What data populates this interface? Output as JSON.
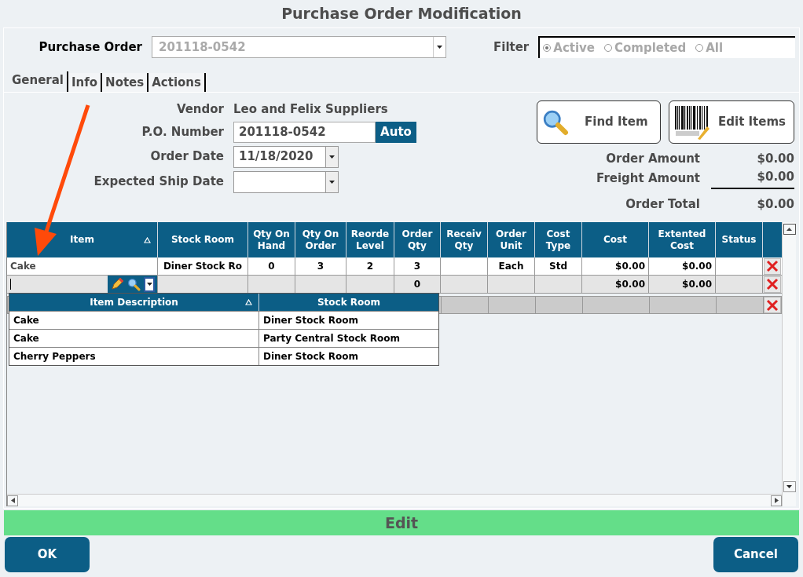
{
  "title": "Purchase Order Modification",
  "purchase_order": {
    "label": "Purchase Order",
    "value": "201118-0542"
  },
  "filter": {
    "label": "Filter",
    "options": [
      {
        "label": "Active",
        "selected": true
      },
      {
        "label": "Completed",
        "selected": false
      },
      {
        "label": "All",
        "selected": false
      }
    ]
  },
  "tabs": [
    {
      "label": "General",
      "selected": true
    },
    {
      "label": "Info",
      "selected": false
    },
    {
      "label": "Notes",
      "selected": false
    },
    {
      "label": "Actions",
      "selected": false
    }
  ],
  "form": {
    "vendor_label": "Vendor",
    "vendor": "Leo and Felix Suppliers",
    "po_label": "P.O. Number",
    "po_value": "201118-0542",
    "auto_button": "Auto",
    "order_date_label": "Order Date",
    "order_date": "11/18/2020",
    "ship_date_label": "Expected Ship Date"
  },
  "find_button": "Find Item",
  "edit_button": "Edit Items",
  "totals": [
    {
      "label": "Order Amount",
      "value": "$0.00"
    },
    {
      "label": "Freight Amount",
      "value": "$0.00"
    },
    {
      "label": "Order Total",
      "value": "$0.00"
    }
  ],
  "grid": {
    "columns": [
      "Item",
      "Stock Room",
      "Qty On Hand",
      "Qty On Order",
      "Reorde Level",
      "Order Qty",
      "Receiv Qty",
      "Order Unit",
      "Cost Type",
      "Cost",
      "Extented Cost",
      "Status"
    ],
    "rows": [
      {
        "kind": "item",
        "cells": [
          "Cake",
          "Diner Stock Ro",
          "0",
          "3",
          "2",
          "3",
          null,
          "Each",
          "Std",
          "$0.00",
          "$0.00",
          null
        ]
      },
      {
        "kind": "new",
        "cells": [
          null,
          null,
          null,
          null,
          null,
          "0",
          null,
          null,
          null,
          "$0.00",
          "$0.00",
          null
        ]
      },
      {
        "kind": "blank"
      }
    ]
  },
  "dropdown": {
    "columns": [
      "Item Description",
      "Stock Room"
    ],
    "rows": [
      [
        "Cake",
        "Diner Stock Room"
      ],
      [
        "Cake",
        "Party Central Stock Room"
      ],
      [
        "Cherry Peppers",
        "Diner Stock Room"
      ]
    ]
  },
  "mode": "Edit",
  "ok_button": "OK",
  "cancel_button": "Cancel"
}
